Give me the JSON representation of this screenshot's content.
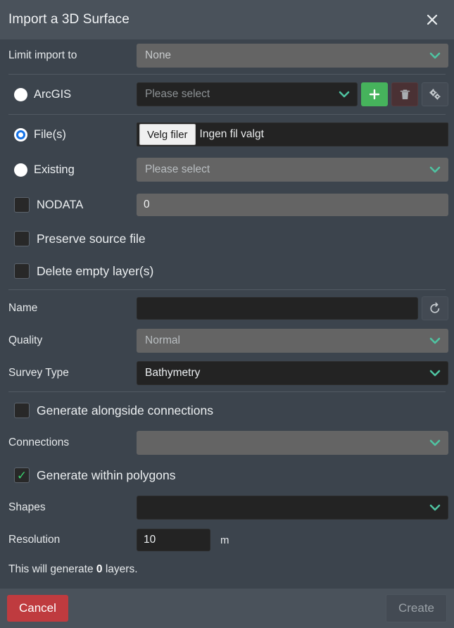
{
  "window": {
    "title": "Import a 3D Surface",
    "close_icon": "close-icon"
  },
  "limit_import": {
    "label": "Limit import to",
    "value": "None",
    "enabled": false
  },
  "source": {
    "arcgis": {
      "label": "ArcGIS",
      "selected": false,
      "select_placeholder": "Please select",
      "add_label": "+",
      "add_icon": "plus-icon",
      "delete_icon": "trash-icon",
      "settings_icon": "gears-icon"
    },
    "files": {
      "label": "File(s)",
      "selected": true,
      "browse_label": "Velg filer",
      "file_status": "Ingen fil valgt"
    },
    "existing": {
      "label": "Existing",
      "selected": false,
      "select_placeholder": "Please select"
    }
  },
  "nodata": {
    "label": "NODATA",
    "checked": false,
    "value": "0"
  },
  "preserve_source_file": {
    "label": "Preserve source file",
    "checked": false
  },
  "delete_empty_layers": {
    "label": "Delete empty layer(s)",
    "checked": false
  },
  "name": {
    "label": "Name",
    "value": "",
    "placeholder": "",
    "reset_icon": "reset-icon"
  },
  "quality": {
    "label": "Quality",
    "value": "Normal",
    "enabled": false
  },
  "survey_type": {
    "label": "Survey Type",
    "value": "Bathymetry",
    "enabled": true
  },
  "generate_alongside_connections": {
    "label": "Generate alongside connections",
    "checked": false
  },
  "connections": {
    "label": "Connections",
    "value": "",
    "enabled": false
  },
  "generate_within_polygons": {
    "label": "Generate within polygons",
    "checked": true,
    "check_glyph": "✓"
  },
  "shapes": {
    "label": "Shapes",
    "value": "",
    "enabled": true
  },
  "resolution": {
    "label": "Resolution",
    "value": "10",
    "unit": "m"
  },
  "summary": {
    "prefix": "This will generate ",
    "count": "0",
    "suffix": " layers."
  },
  "footer": {
    "cancel_label": "Cancel",
    "create_label": "Create"
  },
  "colors": {
    "background": "#3c444d",
    "bar": "#4a525b",
    "accent_green": "#4fc3a1",
    "add_green": "#46b35c",
    "cancel_red": "#bf3b3f",
    "radio_blue": "#1472e6",
    "check_green": "#3ad16e",
    "input_dark": "#232323",
    "input_disabled": "#646464"
  }
}
